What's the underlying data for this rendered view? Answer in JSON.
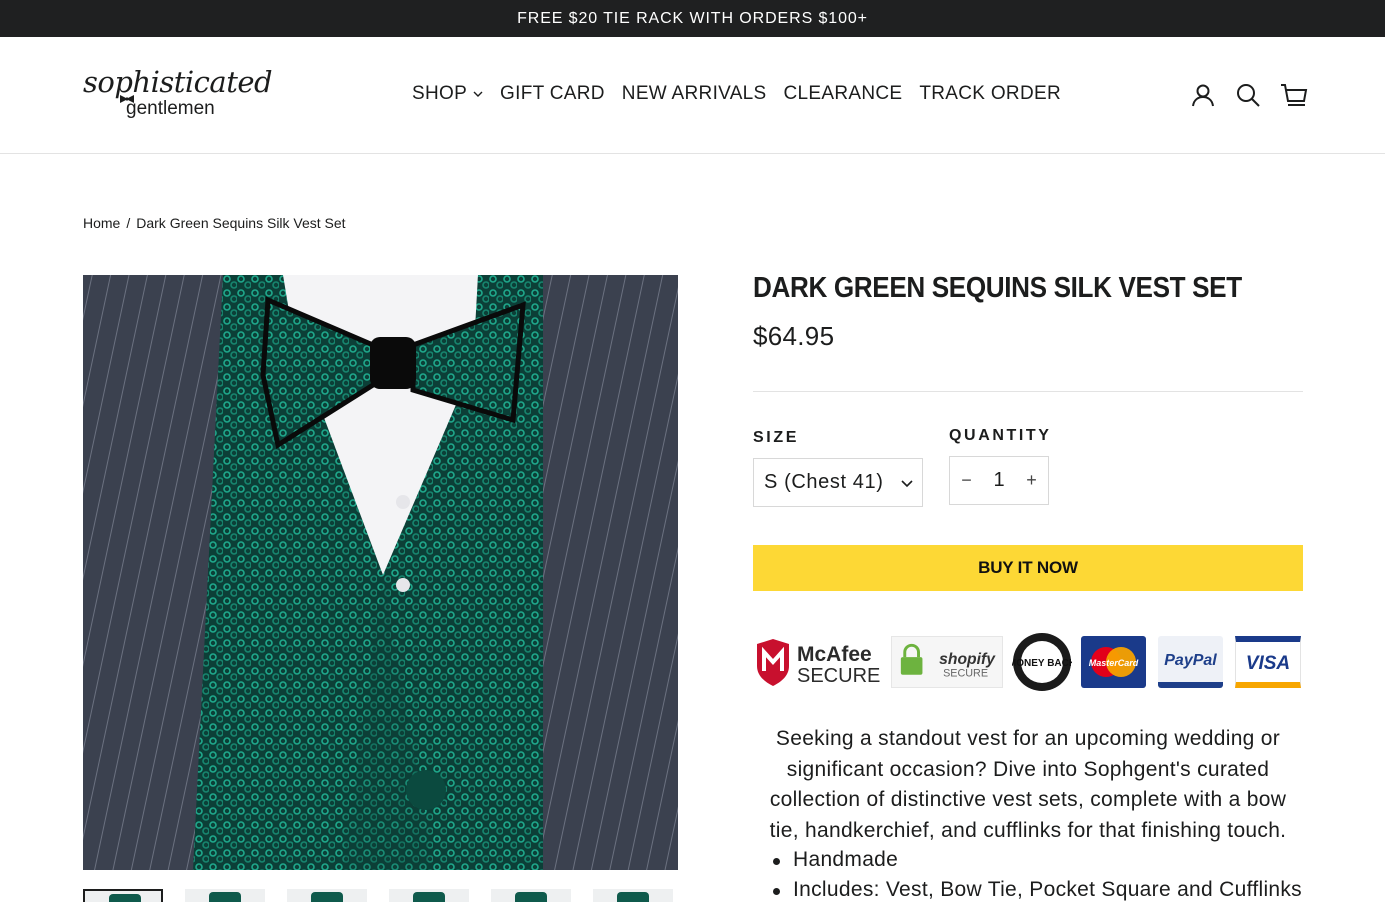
{
  "announcement": {
    "text": "FREE $20 TIE RACK WITH ORDERS $100+"
  },
  "header": {
    "logo": {
      "script": "sophisticated",
      "sub": "gentlemen"
    },
    "nav": [
      {
        "label": "SHOP",
        "has_dropdown": true
      },
      {
        "label": "GIFT CARD"
      },
      {
        "label": "NEW ARRIVALS"
      },
      {
        "label": "CLEARANCE"
      },
      {
        "label": "TRACK ORDER"
      }
    ],
    "icons": [
      "account-icon",
      "search-icon",
      "cart-icon"
    ]
  },
  "breadcrumb": {
    "home": "Home",
    "separator": "/",
    "current": "Dark Green Sequins Silk Vest Set"
  },
  "product": {
    "title": "DARK GREEN SEQUINS SILK VEST SET",
    "price": "$64.95",
    "size_label": "SIZE",
    "size_selected": "S (Chest 41)",
    "quantity_label": "QUANTITY",
    "quantity_minus": "−",
    "quantity_value": "1",
    "quantity_plus": "+",
    "buy_now": "BUY IT NOW",
    "description": "Seeking a standout vest for an upcoming wedding or significant occasion? Dive into Sophgent's curated collection of distinctive vest sets, complete with a bow tie, handkerchief, and cufflinks for that finishing touch.",
    "features": [
      "Handmade",
      "Includes: Vest, Bow Tie, Pocket Square and Cufflinks"
    ]
  },
  "trust_badges": {
    "mcafee_top": "McAfee",
    "mcafee_bottom": "SECURE",
    "shopify_top": "shopify",
    "shopify_bottom": "SECURE",
    "money_back": "MONEY BACK",
    "mastercard": "MasterCard",
    "paypal": "PayPal",
    "visa": "VISA"
  },
  "colors": {
    "announcement_bg": "#1f2021",
    "buy_button": "#fdd835",
    "vest_green": "#0f5a4c",
    "text": "#1c1d1d"
  },
  "thumbnail_count": 6
}
